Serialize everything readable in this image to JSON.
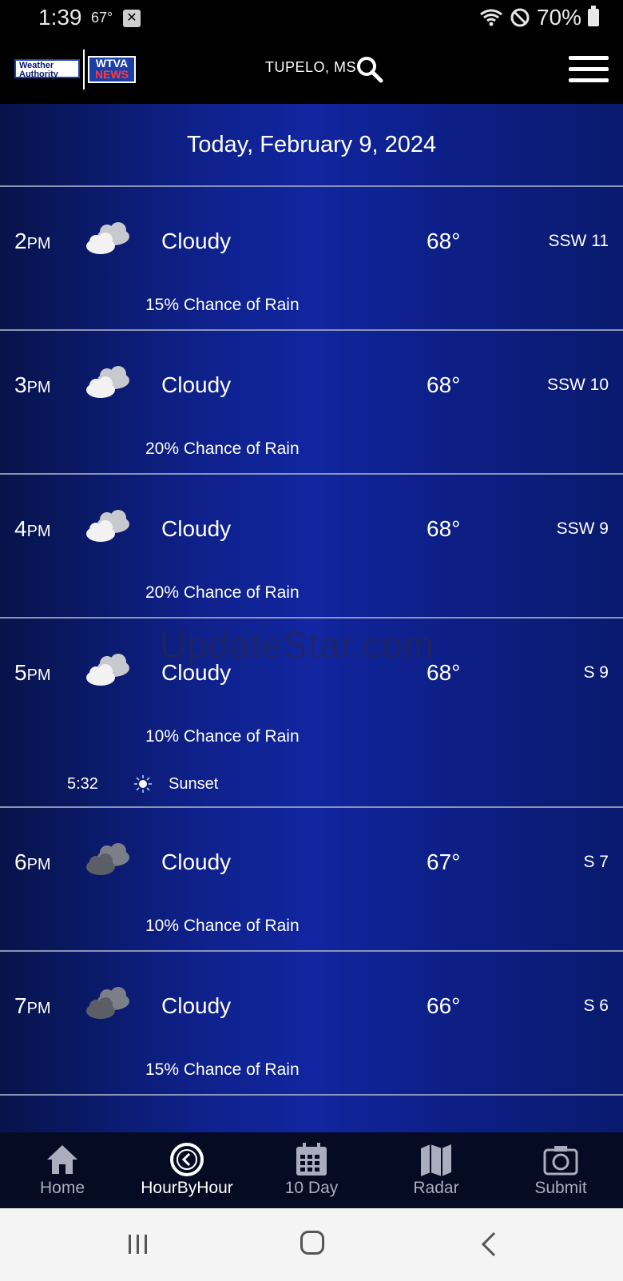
{
  "status_bar": {
    "time": "1:39",
    "temp": "67°",
    "battery": "70%"
  },
  "header": {
    "logo_left": "Weather Authority",
    "logo_right_top": "WTVA",
    "logo_right_bottom": "NEWS",
    "location": "TUPELO, MS"
  },
  "date": "Today, February 9, 2024",
  "hours": [
    {
      "hour": "2",
      "ampm": "PM",
      "condition": "Cloudy",
      "temp": "68°",
      "wind": "SSW 11",
      "rain": "15% Chance of Rain",
      "icon": "partly-cloudy-icon"
    },
    {
      "hour": "3",
      "ampm": "PM",
      "condition": "Cloudy",
      "temp": "68°",
      "wind": "SSW 10",
      "rain": "20% Chance of Rain",
      "icon": "partly-cloudy-icon"
    },
    {
      "hour": "4",
      "ampm": "PM",
      "condition": "Cloudy",
      "temp": "68°",
      "wind": "SSW 9",
      "rain": "20% Chance of Rain",
      "icon": "partly-cloudy-icon"
    },
    {
      "hour": "5",
      "ampm": "PM",
      "condition": "Cloudy",
      "temp": "68°",
      "wind": "S 9",
      "rain": "10% Chance of Rain",
      "icon": "partly-cloudy-icon",
      "sunset_time": "5:32",
      "sunset_label": "Sunset"
    },
    {
      "hour": "6",
      "ampm": "PM",
      "condition": "Cloudy",
      "temp": "67°",
      "wind": "S 7",
      "rain": "10% Chance of Rain",
      "icon": "cloudy-night-icon"
    },
    {
      "hour": "7",
      "ampm": "PM",
      "condition": "Cloudy",
      "temp": "66°",
      "wind": "S 6",
      "rain": "15% Chance of Rain",
      "icon": "cloudy-night-icon"
    }
  ],
  "watermark": "UpdateStar.com",
  "nav": {
    "home": "Home",
    "hourbyhour": "HourByHour",
    "tenday": "10 Day",
    "radar": "Radar",
    "submit": "Submit"
  }
}
